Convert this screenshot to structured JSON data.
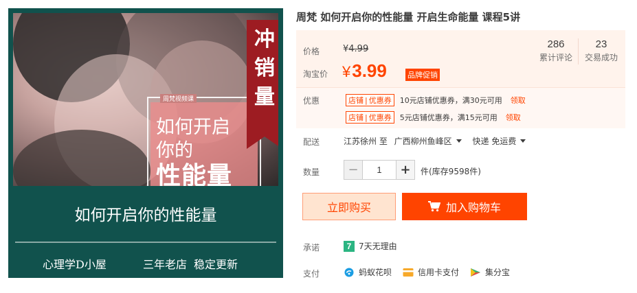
{
  "product_image": {
    "overlay_small": "周梵视频课",
    "overlay_line1": "如何开启",
    "overlay_line2": "你的",
    "overlay_line3": "性能量",
    "ribbon_chars": [
      "冲",
      "销",
      "量"
    ],
    "banner_title": "如何开启你的性能量",
    "footer": [
      "心理学D小屋",
      "三年老店",
      "稳定更新"
    ]
  },
  "title": "周梵 如何开启你的性能量 开启生命能量 课程5讲",
  "price": {
    "original_label": "价格",
    "original_currency": "¥",
    "original_value": "4.99",
    "taobao_label": "淘宝价",
    "current_currency": "¥",
    "current_value": "3.99",
    "promo_badge": "品牌促销"
  },
  "stats": [
    {
      "value": "286",
      "label": "累计评论"
    },
    {
      "value": "23",
      "label": "交易成功"
    }
  ],
  "coupons": {
    "label": "优惠",
    "items": [
      {
        "tag_left": "店铺",
        "tag_sep": "|",
        "tag_right": "优惠券",
        "text": "10元店铺优惠券，满30元可用",
        "action": "领取"
      },
      {
        "tag_left": "店铺",
        "tag_sep": "|",
        "tag_right": "优惠券",
        "text": "5元店铺优惠券，满15元可用",
        "action": "领取"
      }
    ]
  },
  "shipping": {
    "label": "配送",
    "from": "江苏徐州 至",
    "to": "广西柳州鱼峰区",
    "method": "快递 免运费"
  },
  "quantity": {
    "label": "数量",
    "minus": "−",
    "plus": "+",
    "value": "1",
    "stock_text": "件(库存9598件)"
  },
  "actions": {
    "buy_now": "立即购买",
    "add_to_cart": "加入购物车"
  },
  "promise": {
    "label": "承诺",
    "icon_text": "7",
    "text": "7天无理由"
  },
  "payment": {
    "label": "支付",
    "methods": [
      {
        "name": "蚂蚁花呗",
        "icon": "huabei-icon"
      },
      {
        "name": "信用卡支付",
        "icon": "credit-card-icon"
      },
      {
        "name": "集分宝",
        "icon": "jifenbao-icon"
      }
    ]
  },
  "colors": {
    "accent": "#ff4400",
    "image_bg": "#11524d",
    "ribbon": "#9d1c22",
    "price_panel_bg": "#fff3ec"
  }
}
